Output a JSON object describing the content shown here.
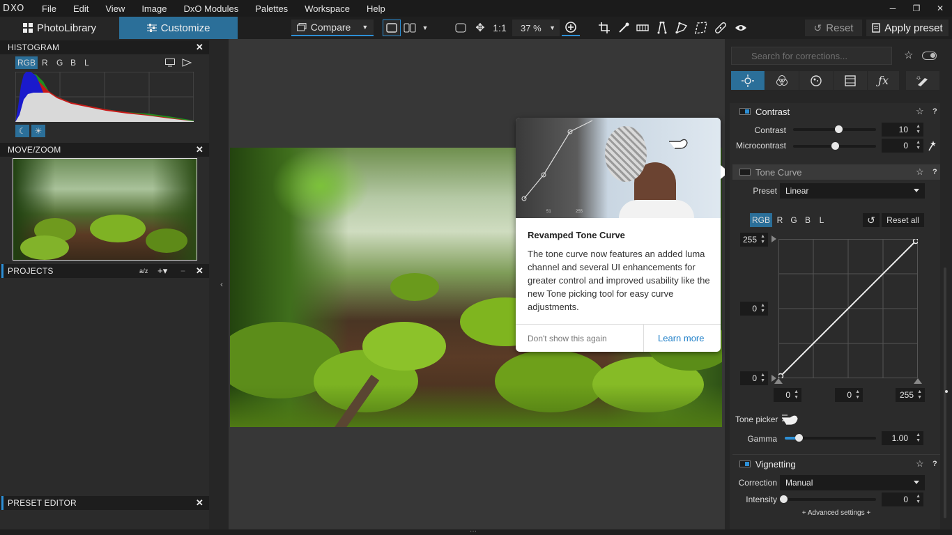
{
  "app": {
    "logo": "DXO"
  },
  "menu": [
    "File",
    "Edit",
    "View",
    "Image",
    "DxO Modules",
    "Palettes",
    "Workspace",
    "Help"
  ],
  "window_controls": {
    "minimize": "─",
    "maximize": "❐",
    "close": "✕"
  },
  "tabs": {
    "photolibrary": "PhotoLibrary",
    "customize": "Customize"
  },
  "toolbar": {
    "compare": "Compare",
    "one_to_one": "1:1",
    "zoom": "37 %",
    "reset": "Reset",
    "apply_preset": "Apply preset"
  },
  "histogram": {
    "title": "HISTOGRAM",
    "channels": [
      "RGB",
      "R",
      "G",
      "B",
      "L"
    ]
  },
  "movezoom": {
    "title": "MOVE/ZOOM"
  },
  "projects": {
    "title": "PROJECTS",
    "sort_icon": "a/z",
    "add": "+▾",
    "collapse": "−"
  },
  "preset_editor": {
    "title": "PRESET EDITOR"
  },
  "tooltip": {
    "title": "Revamped Tone Curve",
    "body": "The tone curve now features an added luma channel and several UI enhancements for greater control and improved usability like the new Tone picking tool for easy curve adjustments.",
    "dismiss": "Don't show this again",
    "learn_more": "Learn more",
    "thumb_values": [
      "51",
      "255"
    ]
  },
  "right_panel": {
    "search_placeholder": "Search for corrections...",
    "contrast": {
      "title": "Contrast",
      "contrast_label": "Contrast",
      "contrast_value": "10",
      "contrast_pct": 0.55,
      "micro_label": "Microcontrast",
      "micro_value": "0",
      "micro_pct": 0.5
    },
    "tone_curve": {
      "title": "Tone Curve",
      "preset_label": "Preset",
      "preset_value": "Linear",
      "channels": [
        "RGB",
        "R",
        "G",
        "B",
        "L"
      ],
      "reset_all": "Reset all",
      "y_top": "255",
      "y_mid": "0",
      "y_bottom": "0",
      "x_left": "0",
      "x_mid": "0",
      "x_right": "255",
      "tone_picker": "Tone picker",
      "gamma_label": "Gamma",
      "gamma_value": "1.00",
      "gamma_pct": 0.15
    },
    "vignetting": {
      "title": "Vignetting",
      "correction_label": "Correction",
      "correction_value": "Manual",
      "intensity_label": "Intensity",
      "intensity_value": "0",
      "intensity_pct": 0,
      "advanced": "+ Advanced settings +"
    }
  },
  "colors": {
    "accent": "#2d8fd5",
    "customize_tab": "#2b6f99",
    "bg": "#262626"
  }
}
